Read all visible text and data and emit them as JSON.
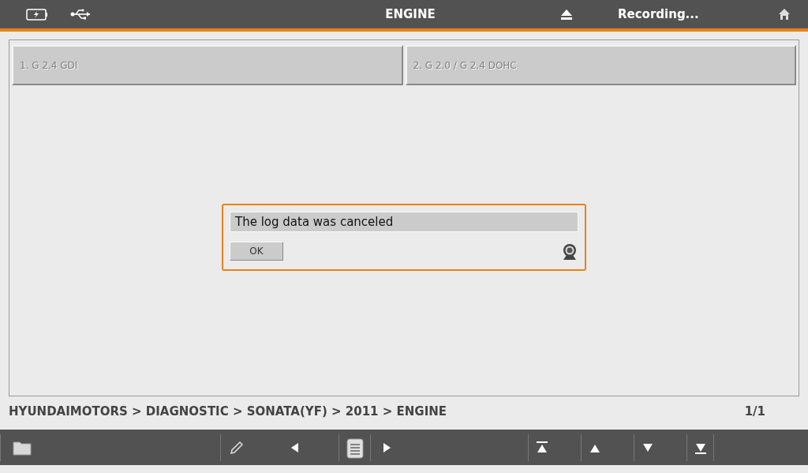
{
  "header": {
    "title": "ENGINE",
    "status": "Recording..."
  },
  "options": [
    {
      "label": "1. G 2.4 GDI",
      "disabled": true
    },
    {
      "label": "2. G 2.0 / G 2.4 DOHC",
      "disabled": true
    }
  ],
  "dialog": {
    "message": "The log data was canceled",
    "button": "OK"
  },
  "breadcrumb": "HYUNDAIMOTORS > DIAGNOSTIC > SONATA(YF) > 2011 > ENGINE",
  "page": "1/1"
}
